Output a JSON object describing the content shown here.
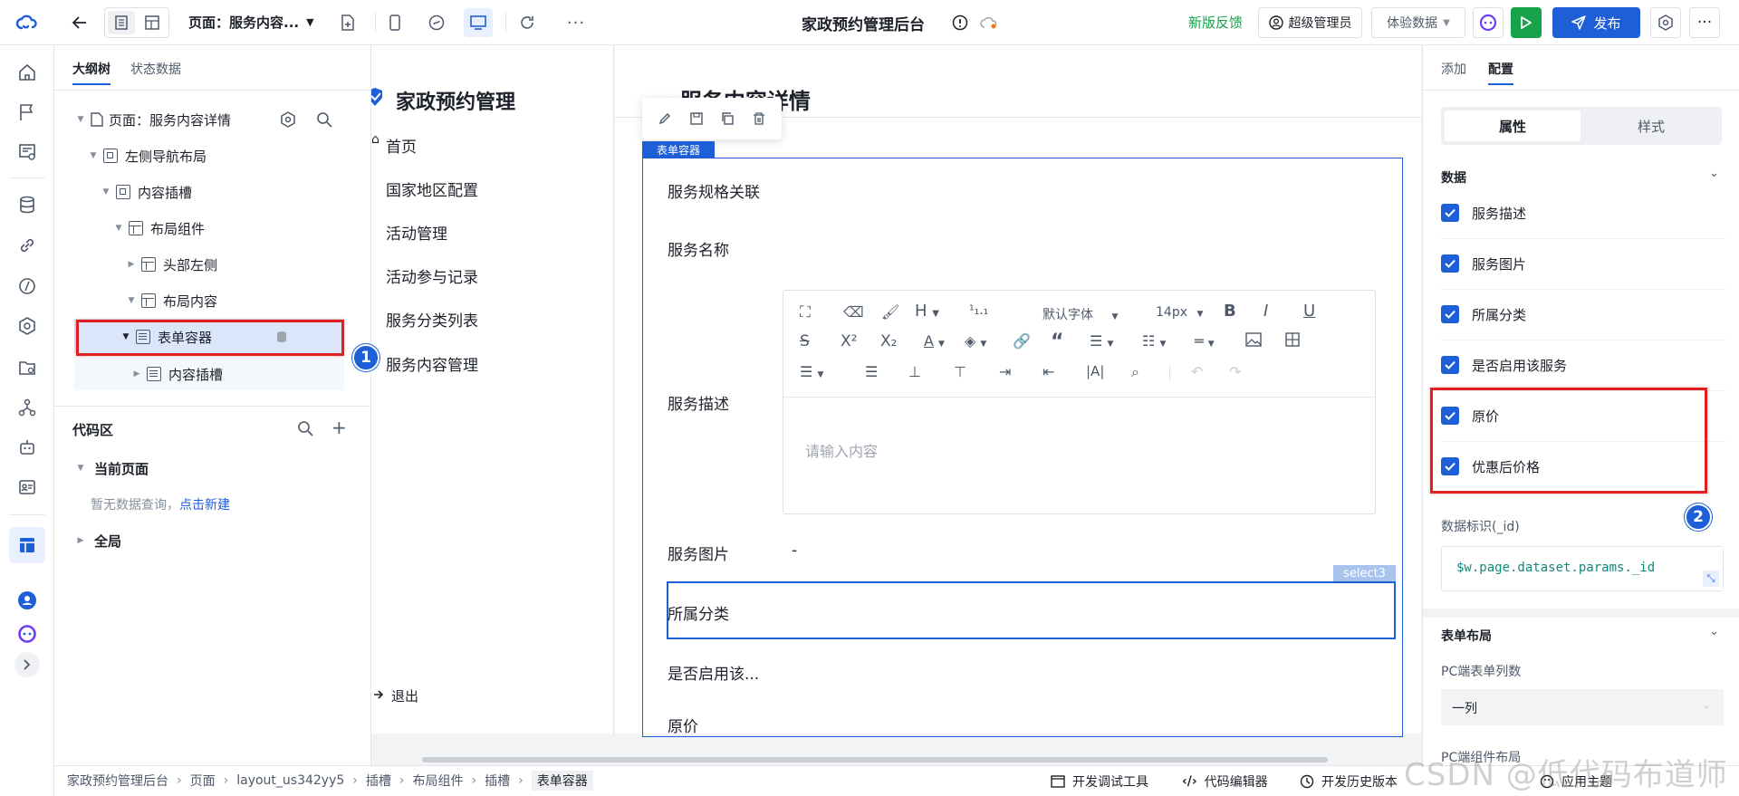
{
  "topbar": {
    "page_label": "页面：服务内容...",
    "app_title": "家政预约管理后台",
    "feedback": "新版反馈",
    "admin": "超级管理员",
    "data_mode": "体验数据",
    "publish": "发布"
  },
  "outline": {
    "tabs": [
      "大纲树",
      "状态数据"
    ],
    "tree": [
      {
        "label": "页面：服务内容详情"
      },
      {
        "label": "左侧导航布局"
      },
      {
        "label": "内容插槽"
      },
      {
        "label": "布局组件"
      },
      {
        "label": "头部左侧"
      },
      {
        "label": "布局内容"
      },
      {
        "label": "表单容器"
      },
      {
        "label": "内容插槽"
      }
    ],
    "code_area": {
      "title": "代码区",
      "current_page": "当前页面",
      "no_query": "暂无数据查询，",
      "create_link": "点击新建",
      "global": "全局"
    }
  },
  "canvas": {
    "brand": "家政预约管理",
    "nav": [
      "首页",
      "国家地区配置",
      "活动管理",
      "活动参与记录",
      "服务分类列表",
      "服务内容管理"
    ],
    "logout": "退出",
    "page_heading": "服务内容详情",
    "form_tag": "表单容器",
    "select_tag": "select3",
    "fields": {
      "spec": "服务规格关联",
      "name": "服务名称",
      "desc": "服务描述",
      "image": "服务图片",
      "image_value": "-",
      "category": "所属分类",
      "enabled": "是否启用该...",
      "price": "原价"
    },
    "editor": {
      "font": "默认字体",
      "size": "14px",
      "placeholder": "请输入内容"
    }
  },
  "right": {
    "tabs": [
      "添加",
      "配置"
    ],
    "subtabs": [
      "属性",
      "样式"
    ],
    "data_section": "数据",
    "checkboxes": [
      "服务描述",
      "服务图片",
      "所属分类",
      "是否启用该服务",
      "原价",
      "优惠后价格"
    ],
    "id_label": "数据标识(_id)",
    "id_value": "$w.page.dataset.params._id",
    "form_layout": "表单布局",
    "pc_columns_label": "PC端表单列数",
    "pc_columns_value": "一列",
    "pc_component_label": "PC端组件布局"
  },
  "bottom": {
    "breadcrumb": [
      "家政预约管理后台",
      "页面",
      "layout_us342yy5",
      "插槽",
      "布局组件",
      "插槽",
      "表单容器"
    ],
    "devtools": "开发调试工具",
    "code_editor": "代码编辑器",
    "history": "开发历史版本",
    "theme": "应用主题"
  },
  "annotations": {
    "badge1": "1",
    "badge2": "2"
  },
  "watermark": "CSDN @低代码布道师",
  "colors": {
    "accent": "#1e5fd8",
    "run": "#16a34a",
    "highlight": "#e02020"
  }
}
